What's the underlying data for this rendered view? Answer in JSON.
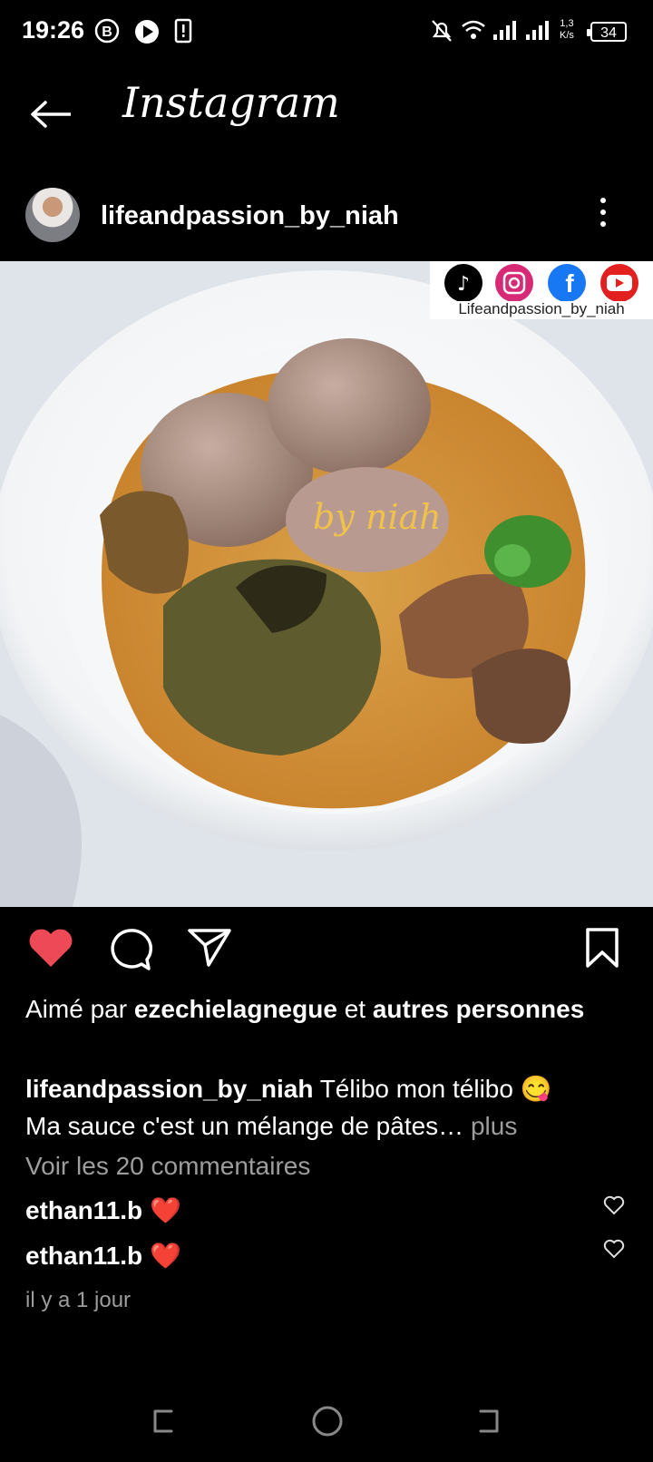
{
  "status_bar": {
    "time": "19:26",
    "net_speed_value": "1,3",
    "net_speed_unit": "K/s",
    "battery": "34"
  },
  "header": {
    "title": "Instagram"
  },
  "post": {
    "username": "lifeandpassion_by_niah",
    "image": {
      "banner_handle": "Lifeandpassion_by_niah",
      "watermark": "by niah"
    },
    "liked_by_prefix": "Aimé par",
    "liked_by_user": "ezechielagnegue",
    "liked_by_mid": "et",
    "liked_by_rest": "autres personnes",
    "caption_user": "lifeandpassion_by_niah",
    "caption_text": "Télibo mon télibo 😋",
    "caption_line2": "Ma sauce c'est un mélange de pâtes…",
    "caption_more": "plus",
    "view_comments": "Voir les 20 commentaires",
    "comments": [
      {
        "user": "ethan11.b",
        "text": "❤️"
      },
      {
        "user": "ethan11.b",
        "text": "❤️"
      }
    ],
    "time_ago": "il y a 1 jour"
  },
  "colors": {
    "like_red": "#ed4956",
    "muted": "#9d9d9d"
  }
}
